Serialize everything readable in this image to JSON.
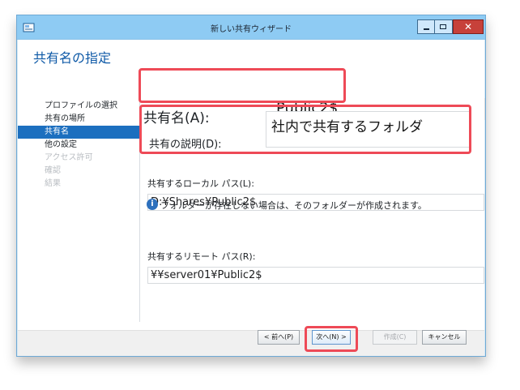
{
  "window": {
    "title": "新しい共有ウィザード",
    "close_symbol": "✕"
  },
  "page": {
    "heading": "共有名の指定"
  },
  "steps": [
    {
      "label": "プロファイルの選択",
      "state": "normal"
    },
    {
      "label": "共有の場所",
      "state": "normal"
    },
    {
      "label": "共有名",
      "state": "active"
    },
    {
      "label": "他の設定",
      "state": "normal"
    },
    {
      "label": "アクセス許可",
      "state": "disabled"
    },
    {
      "label": "確認",
      "state": "disabled"
    },
    {
      "label": "結果",
      "state": "disabled"
    }
  ],
  "form": {
    "share_name_label": "共有名(A):",
    "share_name_value": "Public2$",
    "description_label": "共有の説明(D):",
    "description_value": "社内で共有するフォルダ",
    "local_path_label": "共有するローカル パス(L):",
    "local_path_value": "D:¥Shares¥Public2$",
    "info_text": "フォルダーが存在しない場合は、そのフォルダーが作成されます。",
    "remote_path_label": "共有するリモート パス(R):",
    "remote_path_value": "¥¥server01¥Public2$"
  },
  "buttons": {
    "back": "< 前へ(P)",
    "next": "次へ(N) >",
    "create": "作成(C)",
    "cancel": "キャンセル"
  },
  "icons": {
    "app": "wizard-window-icon",
    "minimize": "minimize-icon",
    "maximize": "maximize-icon",
    "close": "close-icon",
    "info": "info-icon"
  },
  "colors": {
    "titlebar": "#8ecbf3",
    "heading": "#0f5aa7",
    "active_step": "#1c6fbf",
    "highlight": "#ee4a57"
  }
}
